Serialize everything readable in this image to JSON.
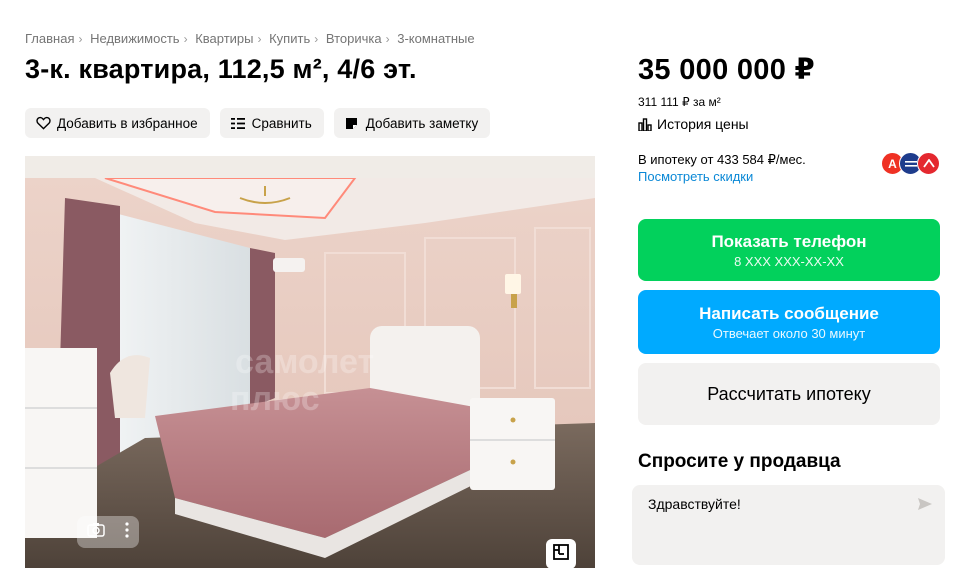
{
  "breadcrumb": [
    "Главная",
    "Недвижимость",
    "Квартиры",
    "Купить",
    "Вторичка",
    "3-комнатные"
  ],
  "title": "3-к. квартира, 112,5 м², 4/6 эт.",
  "actions": {
    "favorite": "Добавить в избранное",
    "compare": "Сравнить",
    "note": "Добавить заметку"
  },
  "gallery": {
    "watermark": "самолет плюс"
  },
  "price": {
    "amount": "35 000 000 ₽",
    "per_m2": "311 111 ₽ за м²",
    "history": "История цены"
  },
  "mortgage": {
    "text": "В ипотеку от 433 584 ₽/мес.",
    "link": "Посмотреть скидки",
    "banks": [
      {
        "letter": "А",
        "color": "#ef3124"
      },
      {
        "letter": "",
        "color": "#1e3c8c"
      },
      {
        "letter": "",
        "color": "#e4282f"
      }
    ]
  },
  "buttons": {
    "phone_main": "Показать телефон",
    "phone_sub": "8 XXX XXX-XX-XX",
    "msg_main": "Написать сообщение",
    "msg_sub": "Отвечает около 30 минут",
    "mortgage_calc": "Рассчитать ипотеку"
  },
  "ask": {
    "title": "Спросите у продавца",
    "message": "Здравствуйте!"
  },
  "colors": {
    "green": "#02d15c",
    "blue": "#00aaff",
    "link": "#0a88d6"
  }
}
